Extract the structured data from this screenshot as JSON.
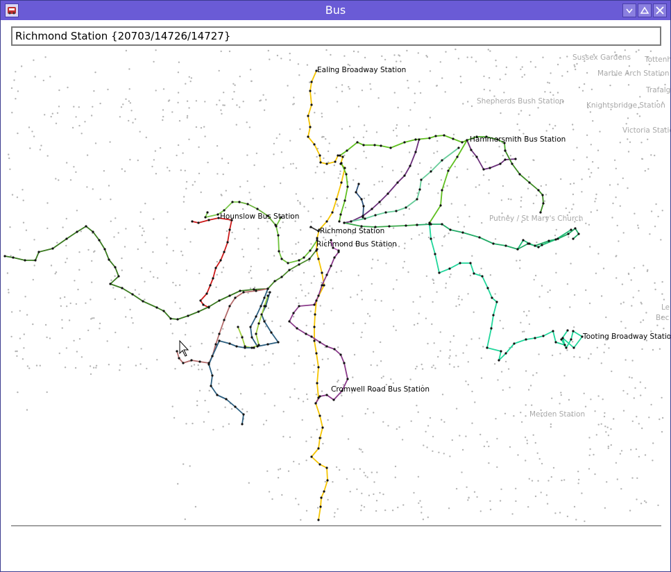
{
  "window": {
    "title": "Bus",
    "controls": [
      "minimize",
      "maximize",
      "close"
    ]
  },
  "address_bar": {
    "value": "Richmond Station {20703/14726/14727}"
  },
  "map": {
    "background_labels": [
      "Sussex Gardens",
      "Tottenh",
      "Marble Arch Station",
      "Trafalg",
      "Shepherds Bush Station",
      "Knightsbridge Station",
      "Victoria Statio",
      "Putney / St Mary's Church",
      "Le",
      "Bec",
      "Merden Station"
    ],
    "station_labels": [
      "Ealing Broadway Station",
      "Hammersmith Bus Station",
      "Hounslow Bus Station",
      "Richmond Station",
      "Richmond Bus Station",
      "Tooting Broadway Station",
      "Cromwell Road Bus Station"
    ],
    "route_colors": [
      "#f5c400",
      "#5fbf1f",
      "#6b2f7a",
      "#1fd69a",
      "#2c5f80",
      "#cc1a1a",
      "#3a7a20",
      "#c060c0",
      "#b36b6b",
      "#a0d040",
      "#66cc99",
      "#2a4f7a"
    ]
  }
}
